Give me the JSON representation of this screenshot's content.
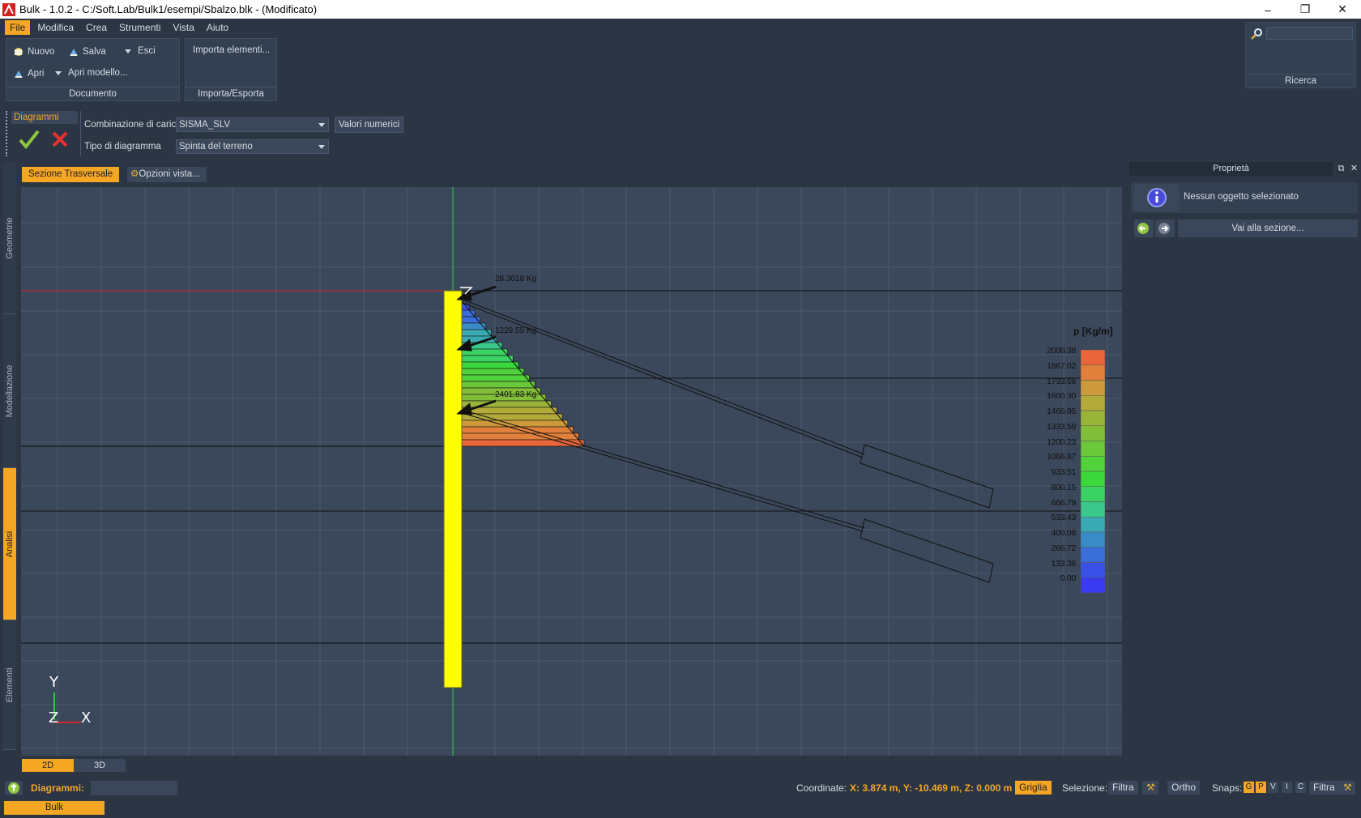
{
  "window": {
    "title": "Bulk - 1.0.2 - C:/Soft.Lab/Bulk1/esempi/Sbalzo.blk - (Modificato)"
  },
  "menu": [
    "File",
    "Modifica",
    "Crea",
    "Strumenti",
    "Vista",
    "Aiuto"
  ],
  "ribbon": {
    "documento": {
      "label": "Documento",
      "nuovo": "Nuovo",
      "salva": "Salva",
      "esci": "Esci",
      "apri": "Apri",
      "apri_modello": "Apri modello..."
    },
    "importa": {
      "label": "Importa/Esporta",
      "importa_elementi": "Importa elementi..."
    },
    "ricerca": {
      "label": "Ricerca",
      "placeholder": ""
    }
  },
  "diagrammi": {
    "title": "Diagrammi",
    "combinazione_label": "Combinazione di carico",
    "combinazione_value": "SISMA_SLV",
    "valori_numerici": "Valori numerici",
    "tipo_label": "Tipo di diagramma",
    "tipo_value": "Spinta del terreno"
  },
  "side_tabs": [
    "Geometrie",
    "Modellazione",
    "Analisi",
    "Elementi"
  ],
  "view_tabs": {
    "sezione": "Sezione Trasversale",
    "opzioni": "Opzioni vista..."
  },
  "canvas": {
    "anchor_forces": [
      "28.3018 Kg",
      "1229.55 Kg",
      "2401.83 Kg"
    ],
    "axes": {
      "y": "Y",
      "z": "Z",
      "x": "X"
    }
  },
  "legend": {
    "title": "p [Kg/m]",
    "values": [
      "2000.38",
      "1867.02",
      "1733.66",
      "1600.30",
      "1466.95",
      "1333.59",
      "1200.23",
      "1066.87",
      "933.51",
      "800.15",
      "666.79",
      "533.43",
      "400.08",
      "266.72",
      "133.36",
      "0.00"
    ],
    "colors": [
      "#e8663a",
      "#e0803a",
      "#cc9a3a",
      "#b4aa3a",
      "#9ab43a",
      "#82be3a",
      "#6ac83a",
      "#52d23a",
      "#3ad83a",
      "#3ad264",
      "#3ac88c",
      "#3aaab4",
      "#3a8cc8",
      "#3a6ed8",
      "#3a50e6",
      "#3a3af0"
    ]
  },
  "bottom_tabs": [
    "2D",
    "3D"
  ],
  "properties": {
    "title": "Proprietà",
    "none_selected": "Nessun oggetto selezionato",
    "goto": "Vai alla sezione..."
  },
  "status": {
    "label": "Diagrammi:",
    "coord_label": "Coordinate:",
    "coord_value": "X: 3.874 m, Y: -10.469 m, Z: 0.000 m",
    "griglia": "Griglia",
    "selezione": "Selezione:",
    "filtra": "Filtra",
    "ortho": "Ortho",
    "snaps": "Snaps:",
    "snap_keys": [
      "G",
      "P",
      "V",
      "I",
      "C"
    ],
    "filtra2": "Filtra"
  },
  "module_tab": "Bulk"
}
